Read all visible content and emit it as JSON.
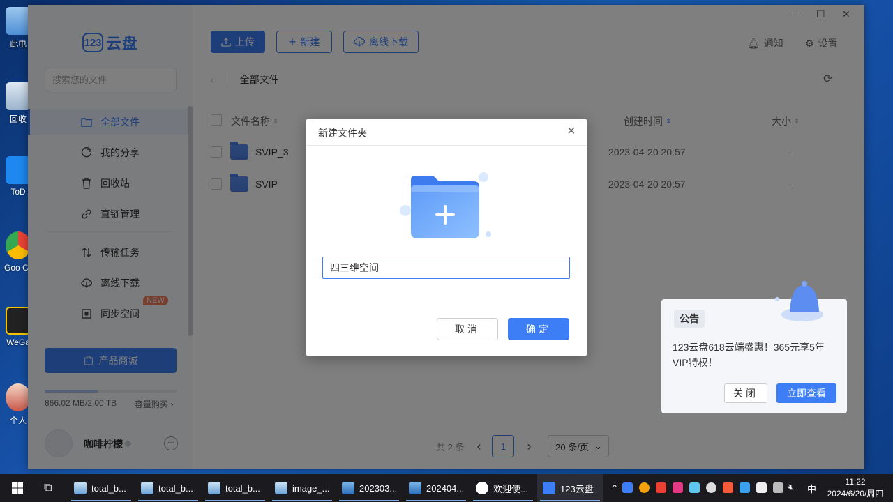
{
  "desktop": {
    "icons": [
      "此电",
      "回收",
      "ToD",
      "Goo Chro",
      "WeGa",
      "个人"
    ]
  },
  "app": {
    "logo_badge": "123",
    "logo_name": "云盘",
    "search_placeholder": "搜索您的文件",
    "nav": [
      {
        "label": "全部文件",
        "icon": "folder-icon"
      },
      {
        "label": "我的分享",
        "icon": "share-icon"
      },
      {
        "label": "回收站",
        "icon": "trash-icon"
      },
      {
        "label": "直链管理",
        "icon": "link-icon"
      },
      {
        "label": "传输任务",
        "icon": "transfer-icon"
      },
      {
        "label": "离线下载",
        "icon": "cloud-download-icon"
      },
      {
        "label": "同步空间",
        "icon": "sync-icon"
      }
    ],
    "new_badge": "NEW",
    "shop_label": "产品商城",
    "quota": {
      "used_text": "866.02 MB/2.00 TB",
      "buy_label": "容量购买",
      "used_fraction": 0.0004
    },
    "user": {
      "name": "咖啡柠檬",
      "more": "···"
    },
    "toolbar": {
      "upload": "上传",
      "new": "新建",
      "offline": "离线下载",
      "notify": "通知",
      "settings": "设置"
    },
    "breadcrumb": {
      "current": "全部文件"
    },
    "columns": {
      "name": "文件名称",
      "created": "创建时间",
      "size": "大小"
    },
    "rows": [
      {
        "name": "SVIP_3",
        "created": "2023-04-20 20:57",
        "size": "-"
      },
      {
        "name": "SVIP",
        "created": "2023-04-20 20:57",
        "size": "-"
      }
    ],
    "pager": {
      "total": "共 2 条",
      "page": "1",
      "per_page": "20 条/页"
    }
  },
  "dialog": {
    "title": "新建文件夹",
    "input_value": "四三维空间",
    "cancel": "取消",
    "ok": "确定"
  },
  "notice": {
    "tag": "公告",
    "text": "123云盘618云端盛惠！365元享5年VIP特权！",
    "close": "关闭",
    "view": "立即查看"
  },
  "taskbar": {
    "items": [
      "total_b...",
      "total_b...",
      "total_b...",
      "image_...",
      "202303...",
      "202404...",
      "欢迎使...",
      "123云盘"
    ],
    "ime": "中",
    "time": "11:22",
    "date": "2024/6/20/周四"
  }
}
